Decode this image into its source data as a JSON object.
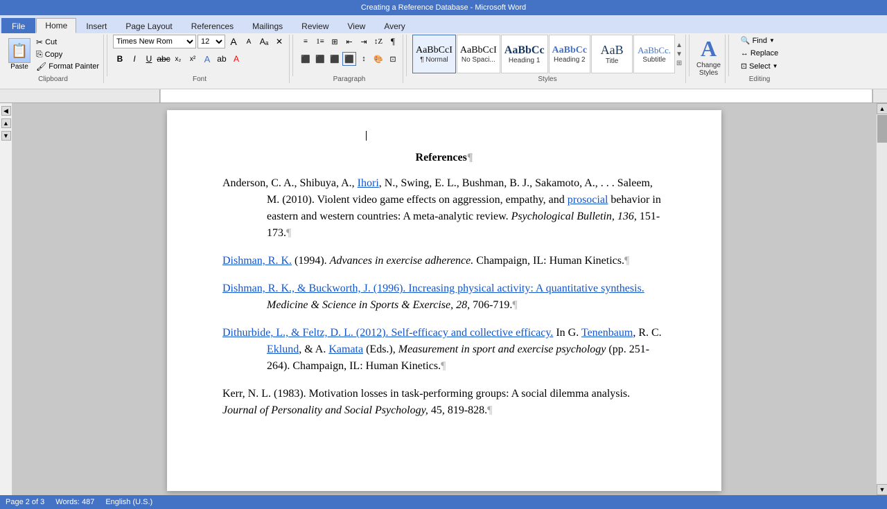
{
  "titlebar": {
    "text": "Creating a Reference Database - Microsoft Word"
  },
  "tabs": [
    {
      "label": "File",
      "id": "file",
      "active": false
    },
    {
      "label": "Home",
      "id": "home",
      "active": true
    },
    {
      "label": "Insert",
      "id": "insert",
      "active": false
    },
    {
      "label": "Page Layout",
      "id": "page-layout",
      "active": false
    },
    {
      "label": "References",
      "id": "references",
      "active": false
    },
    {
      "label": "Mailings",
      "id": "mailings",
      "active": false
    },
    {
      "label": "Review",
      "id": "review",
      "active": false
    },
    {
      "label": "View",
      "id": "view",
      "active": false
    },
    {
      "label": "Avery",
      "id": "avery",
      "active": false
    }
  ],
  "ribbon": {
    "clipboard": {
      "label": "Clipboard",
      "paste_label": "Paste",
      "cut_label": "Cut",
      "copy_label": "Copy",
      "format_painter_label": "Format Painter"
    },
    "font": {
      "label": "Font",
      "font_name": "Times New Rom",
      "font_size": "12",
      "bold": "B",
      "italic": "I",
      "underline": "U",
      "strikethrough": "abc",
      "subscript": "x₂",
      "superscript": "x²"
    },
    "paragraph": {
      "label": "Paragraph"
    },
    "styles": {
      "label": "Styles",
      "items": [
        {
          "preview": "AaBbCcI",
          "label": "¶ Normal",
          "active": true
        },
        {
          "preview": "AaBbCcI",
          "label": "No Spaci..."
        },
        {
          "preview": "AaBbCc",
          "label": "Heading 1"
        },
        {
          "preview": "AaBbCc",
          "label": "Heading 2"
        },
        {
          "preview": "AaB",
          "label": "Title"
        },
        {
          "preview": "AaBbCc.",
          "label": "Subtitle"
        }
      ]
    },
    "change_styles": {
      "label": "Change\nStyles",
      "icon": "A"
    },
    "editing": {
      "label": "Editing",
      "find_label": "Find",
      "replace_label": "Replace",
      "select_label": "Select"
    }
  },
  "document": {
    "title": "References¶",
    "references": [
      {
        "id": 1,
        "text": "Anderson, C. A., Shibuya, A., Ihori, N., Swing, E. L., Bushman, B. J., Sakamoto, A., . . . Saleem, M. (2010). Violent video game effects on aggression, empathy, and prosocial behavior in eastern and western countries: A meta-analytic review. Psychological Bulletin, 136, 151-173.¶",
        "has_underline_start": true,
        "underline_words": [
          "Ihori",
          "prosocial"
        ]
      },
      {
        "id": 2,
        "text": "Dishman, R. K. (1994). Advances in exercise adherence. Champaign, IL: Human Kinetics.¶",
        "italic_part": "Advances in exercise adherence."
      },
      {
        "id": 3,
        "text": "Dishman, R. K., & Buckworth, J. (1996). Increasing physical activity: A quantitative synthesis. Medicine & Science in Sports & Exercise, 28, 706-719.¶",
        "italic_part": "Medicine & Science in Sports & Exercise,"
      },
      {
        "id": 4,
        "text": "Dithurbide, L., & Feltz, D. L. (2012). Self-efficacy and collective efficacy. In G. Tenenbaum, R. C. Eklund, & A. Kamata (Eds.), Measurement in sport and exercise psychology (pp. 251-264). Champaign, IL: Human Kinetics.¶",
        "italic_part": "Measurement in sport and exercise psychology",
        "underline_words": [
          "Tenenbaum",
          "Kamata"
        ]
      },
      {
        "id": 5,
        "text": "Kerr, N. L. (1983). Motivation losses in task-performing groups: A social dilemma analysis. Journal of Personality and Social Psychology, 45, 819-828.¶",
        "italic_part": "Journal of Personality and Social Psychology,"
      }
    ]
  },
  "statusbar": {
    "page_info": "Page 2 of 3",
    "word_count": "Words: 487",
    "language": "English (U.S.)"
  }
}
